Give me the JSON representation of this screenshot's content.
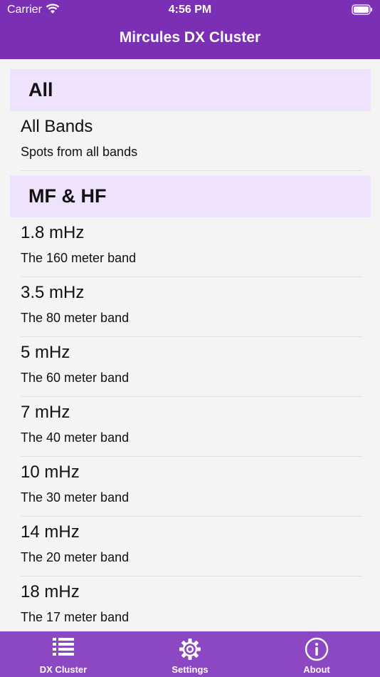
{
  "status": {
    "carrier": "Carrier",
    "time": "4:56 PM"
  },
  "nav": {
    "title": "Mircules DX Cluster"
  },
  "sections": [
    {
      "header": "All",
      "rows": [
        {
          "title": "All Bands",
          "subtitle": "Spots from all bands"
        }
      ]
    },
    {
      "header": "MF & HF",
      "rows": [
        {
          "title": "1.8 mHz",
          "subtitle": "The 160 meter band"
        },
        {
          "title": "3.5 mHz",
          "subtitle": "The 80 meter band"
        },
        {
          "title": "5 mHz",
          "subtitle": "The 60 meter band"
        },
        {
          "title": "7 mHz",
          "subtitle": "The 40 meter band"
        },
        {
          "title": "10 mHz",
          "subtitle": "The 30 meter band"
        },
        {
          "title": "14 mHz",
          "subtitle": "The 20 meter band"
        },
        {
          "title": "18 mHz",
          "subtitle": "The 17 meter band"
        }
      ]
    }
  ],
  "tabs": [
    {
      "label": "DX Cluster",
      "icon": "list-icon"
    },
    {
      "label": "Settings",
      "icon": "gear-icon"
    },
    {
      "label": "About",
      "icon": "info-icon"
    }
  ],
  "colors": {
    "header": "#7b2fb4",
    "tabbar": "#8b48c2",
    "section_header": "#efe2fc"
  }
}
